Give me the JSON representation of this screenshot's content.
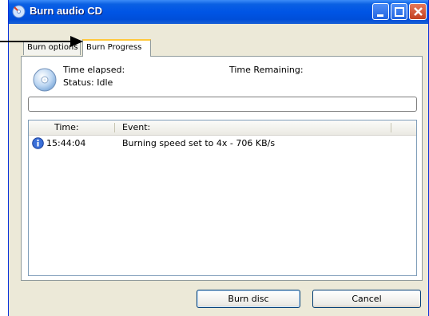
{
  "window": {
    "title": "Burn audio CD"
  },
  "tabs": {
    "burn_options": "Burn options",
    "burn_progress": "Burn Progress"
  },
  "status": {
    "time_elapsed_label": "Time elapsed:",
    "time_remaining_label": "Time Remaining:",
    "status_text": "Status: Idle"
  },
  "log": {
    "col_time": "Time:",
    "col_event": "Event:",
    "rows": [
      {
        "icon": "info-icon",
        "time": "15:44:04",
        "event": "Burning speed set to 4x - 706 KB/s"
      }
    ]
  },
  "buttons": {
    "burn_disc": "Burn disc",
    "cancel": "Cancel"
  },
  "colors": {
    "titlebar": "#0055e5",
    "tab_highlight": "#ffc83c",
    "window_bg": "#ece9d8"
  }
}
